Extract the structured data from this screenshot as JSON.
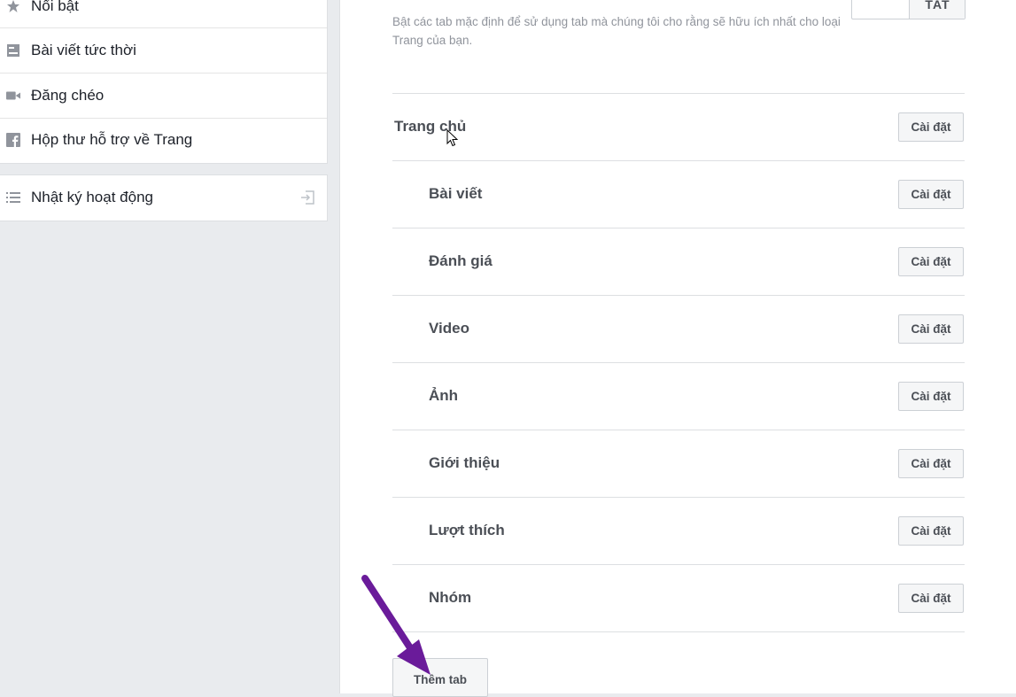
{
  "sidebar": {
    "items": [
      {
        "label": "Nổi bật",
        "icon": "star-icon"
      },
      {
        "label": "Bài viết tức thời",
        "icon": "instant-article-icon"
      },
      {
        "label": "Đăng chéo",
        "icon": "video-camera-icon"
      },
      {
        "label": "Hộp thư hỗ trợ về Trang",
        "icon": "facebook-icon"
      }
    ],
    "activity_log": {
      "label": "Nhật ký hoạt động",
      "icon": "list-icon",
      "action_icon": "enter-icon"
    }
  },
  "main": {
    "description": "Bật các tab mặc định để sử dụng tab mà chúng tôi cho rằng sẽ hữu ích nhất cho loại Trang của bạn.",
    "toggle": {
      "on_label": "TẮT"
    },
    "tabs": [
      {
        "label": "Trang chủ",
        "button": "Cài đặt"
      },
      {
        "label": "Bài viết",
        "button": "Cài đặt"
      },
      {
        "label": "Đánh giá",
        "button": "Cài đặt"
      },
      {
        "label": "Video",
        "button": "Cài đặt"
      },
      {
        "label": "Ảnh",
        "button": "Cài đặt"
      },
      {
        "label": "Giới thiệu",
        "button": "Cài đặt"
      },
      {
        "label": "Lượt thích",
        "button": "Cài đặt"
      },
      {
        "label": "Nhóm",
        "button": "Cài đặt"
      }
    ],
    "add_tab_label": "Thêm tab"
  },
  "colors": {
    "annotation_arrow": "#6a1b9a",
    "panel_bg": "#ffffff",
    "page_bg": "#e9ebee"
  }
}
